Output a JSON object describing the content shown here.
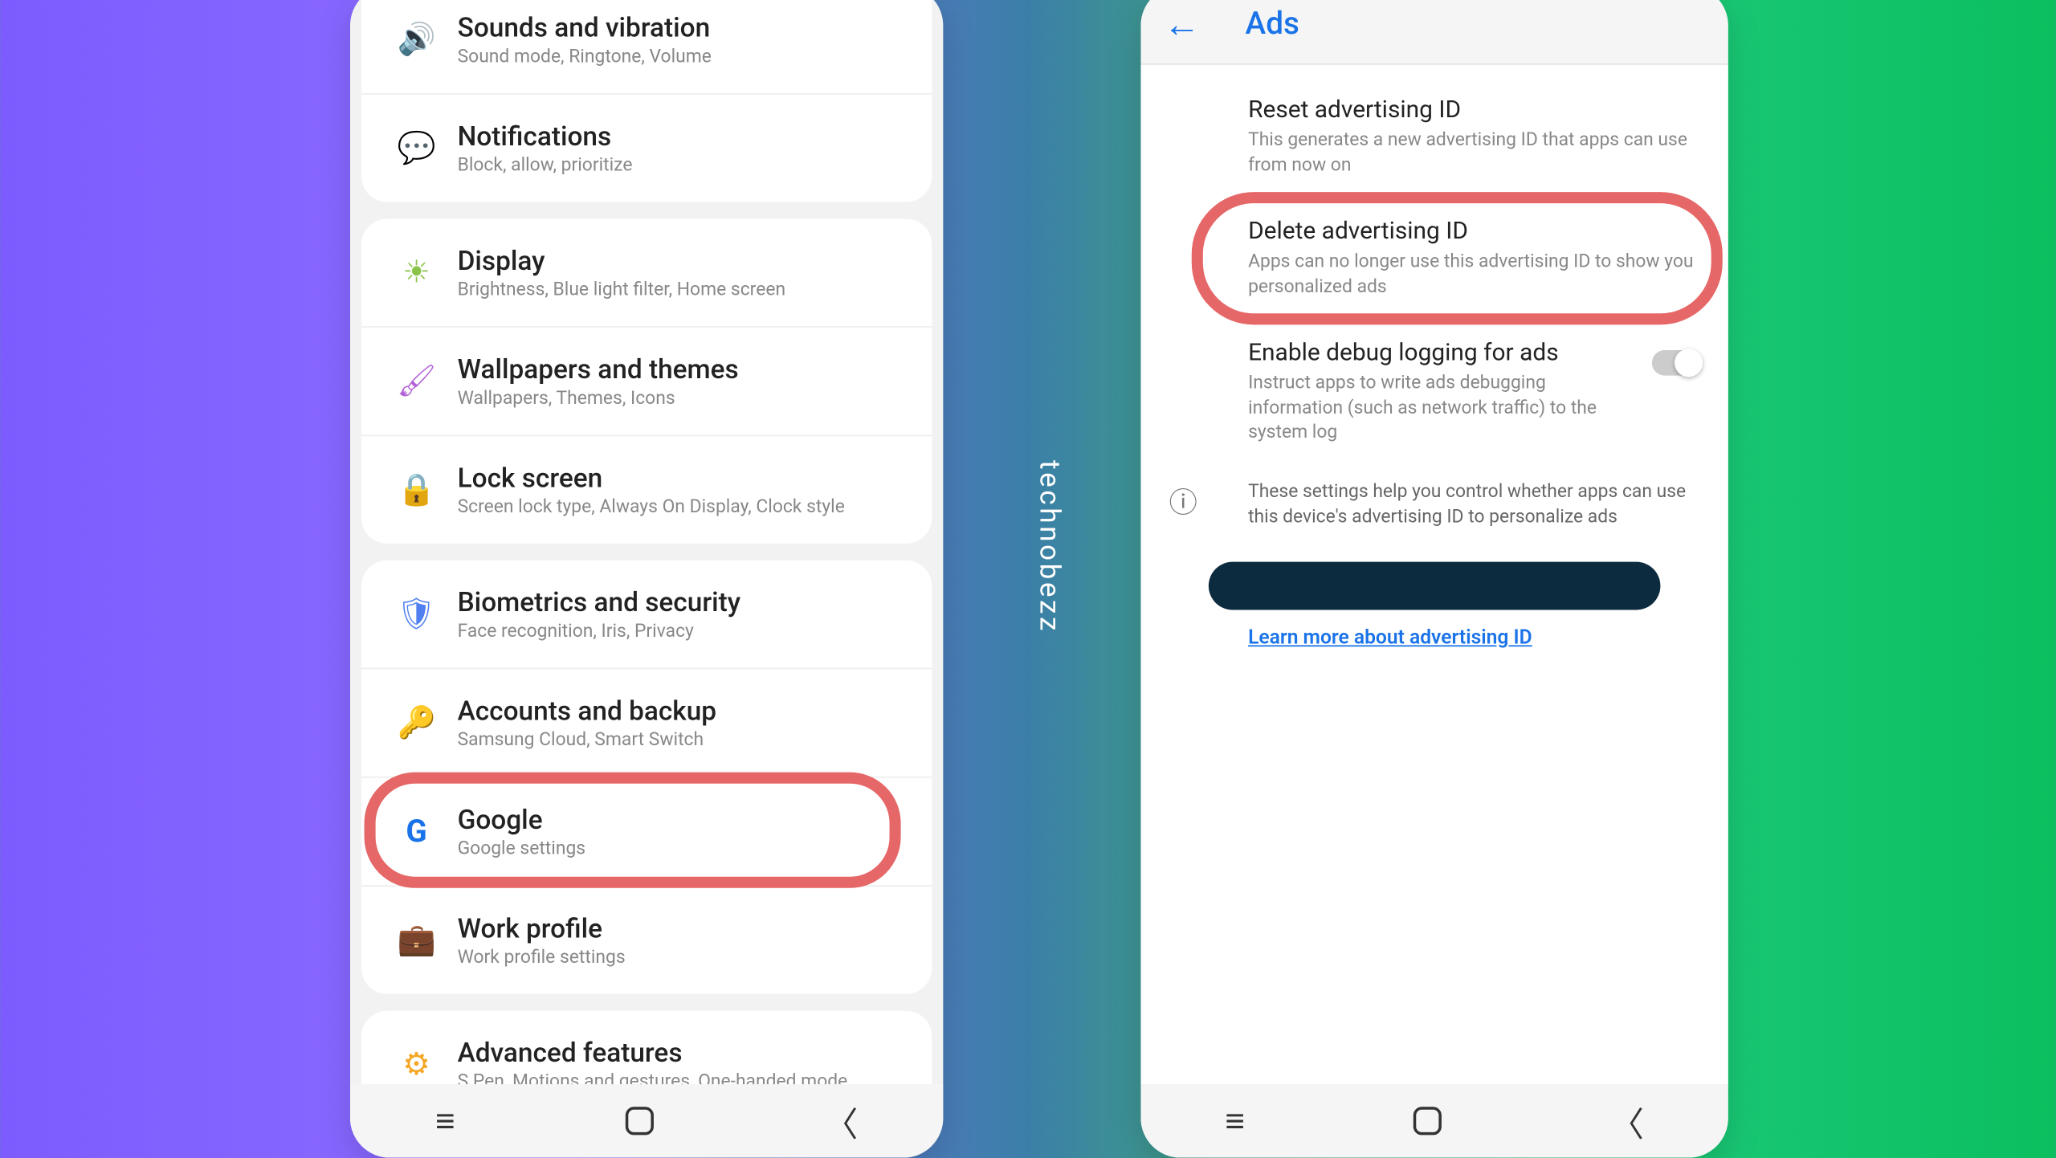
{
  "brand": "technobezz",
  "left": {
    "groups": [
      [
        {
          "title": "Sounds and vibration",
          "sub": "Sound mode, Ringtone, Volume",
          "icon": "sound"
        },
        {
          "title": "Notifications",
          "sub": "Block, allow, prioritize",
          "icon": "notif"
        }
      ],
      [
        {
          "title": "Display",
          "sub": "Brightness, Blue light filter, Home screen",
          "icon": "display"
        },
        {
          "title": "Wallpapers and themes",
          "sub": "Wallpapers, Themes, Icons",
          "icon": "wall"
        },
        {
          "title": "Lock screen",
          "sub": "Screen lock type, Always On Display, Clock style",
          "icon": "lock"
        }
      ],
      [
        {
          "title": "Biometrics and security",
          "sub": "Face recognition, Iris, Privacy",
          "icon": "bio"
        },
        {
          "title": "Accounts and backup",
          "sub": "Samsung Cloud, Smart Switch",
          "icon": "acct"
        },
        {
          "title": "Google",
          "sub": "Google settings",
          "icon": "google",
          "highlight": true
        },
        {
          "title": "Work profile",
          "sub": "Work profile settings",
          "icon": "work"
        }
      ],
      [
        {
          "title": "Advanced features",
          "sub": "S Pen, Motions and gestures, One-handed mode",
          "icon": "adv"
        }
      ]
    ]
  },
  "right": {
    "header": "Ads",
    "items": [
      {
        "title": "Reset advertising ID",
        "sub": "This generates a new advertising ID that apps can use from now on",
        "highlight": false
      },
      {
        "title": "Delete advertising ID",
        "sub": "Apps can no longer use this advertising ID to show you personalized ads",
        "highlight": true
      },
      {
        "title": "Enable debug logging for ads",
        "sub": "Instruct apps to write ads debugging information (such as network traffic) to the system log",
        "switch": true
      }
    ],
    "info": "These settings help you control whether apps can use this device's advertising ID to personalize ads",
    "link": "Learn more about advertising ID"
  }
}
